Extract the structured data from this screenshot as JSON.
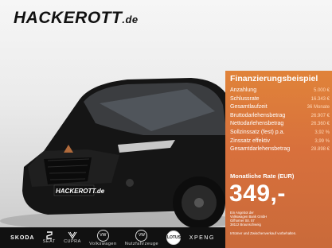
{
  "logo": {
    "name": "HACKEROTT",
    "suffix": ".de"
  },
  "panel": {
    "title": "Finanzierungsbeispiel",
    "rows": [
      {
        "label": "Anzahlung",
        "value": "5.000 €"
      },
      {
        "label": "Schlussrate",
        "value": "16.343 €"
      },
      {
        "label": "Gesamtlaufzeit",
        "value": "36 Monate"
      },
      {
        "label": "Bruttodarlehensbetrag",
        "value": "26.907 €"
      },
      {
        "label": "Nettodarlehensbetrag",
        "value": "26.360 €"
      },
      {
        "label": "Sollzinssatz (fest) p.a.",
        "value": "3,92 %"
      },
      {
        "label": "Zinssatz effektiv",
        "value": "3,99 %"
      },
      {
        "label": "Gesamtdarlehensbetrag",
        "value": "28.898 €"
      }
    ],
    "rate_label": "Monatliche Rate (EUR)",
    "rate_value": "349,-",
    "offer_lines": [
      "Ein Angebot der",
      "Volkswagen Bank GmbH",
      "Gifhorner Str. 57",
      "38112 Braunschweig"
    ],
    "disclaimer": "Irrtümer und Zwischenverkauf vorbehalten."
  },
  "car_plate": "HACKEROTT.de",
  "brands": [
    "SKODA",
    "SEAT",
    "CUPRA",
    "Volkswagen",
    "Nutzfahrzeuge",
    "LOTUS",
    "XPENG"
  ],
  "colors": {
    "panel": "#d8703c",
    "brand_bar": "#111111"
  }
}
